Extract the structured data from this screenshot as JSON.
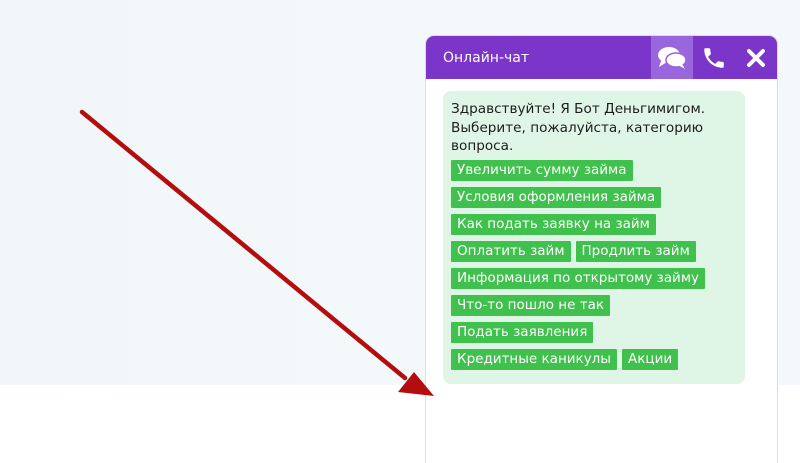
{
  "colors": {
    "header": "#7b35c9",
    "header_active_button": "#9a66dd",
    "bubble": "#dff5e6",
    "option_button": "#40c14d",
    "arrow": "#b30d0d"
  },
  "chat": {
    "title": "Онлайн-чат",
    "header_icons": [
      "chat-bubbles-icon",
      "phone-icon",
      "close-icon"
    ],
    "greeting": "Здравствуйте! Я Бот Деньгимигом.\nВыберите, пожалуйста, категорию\nвопроса.",
    "options": [
      "Увеличить сумму займа",
      "Условия оформления займа",
      "Как подать заявку на займ",
      "Оплатить займ",
      "Продлить займ",
      "Информация по открытому займу",
      "Что-то пошло не так",
      "Подать заявления",
      "Кредитные каникулы",
      "Акции"
    ]
  },
  "annotation": {
    "icon": "red-arrow-icon"
  }
}
